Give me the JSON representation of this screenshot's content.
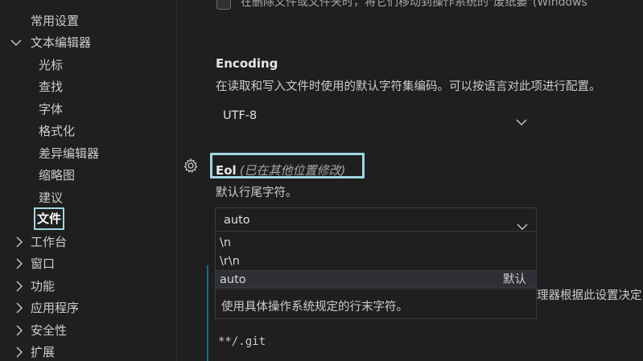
{
  "sidebar": {
    "items": [
      {
        "label": "常用设置",
        "expandable": false
      },
      {
        "label": "文本编辑器",
        "expandable": true,
        "expanded": true
      },
      {
        "label": "光标",
        "child": true
      },
      {
        "label": "查找",
        "child": true
      },
      {
        "label": "字体",
        "child": true
      },
      {
        "label": "格式化",
        "child": true
      },
      {
        "label": "差异编辑器",
        "child": true
      },
      {
        "label": "缩略图",
        "child": true
      },
      {
        "label": "建议",
        "child": true
      },
      {
        "label": "文件",
        "child": true,
        "active": true
      },
      {
        "label": "工作台",
        "expandable": true
      },
      {
        "label": "窗口",
        "expandable": true
      },
      {
        "label": "功能",
        "expandable": true
      },
      {
        "label": "应用程序",
        "expandable": true
      },
      {
        "label": "安全性",
        "expandable": true
      },
      {
        "label": "扩展",
        "expandable": true
      }
    ]
  },
  "main": {
    "top_clipped": "在删除文件或文件夹时，将它们移动到操作系统的\"废纸篓\"(Windows",
    "encoding": {
      "title": "Encoding",
      "description": "在读取和写入文件时使用的默认字符集编码。可以按语言对此项进行配置。",
      "value": "UTF-8"
    },
    "eol": {
      "title": "Eol",
      "modified_note": "(已在其他位置修改)",
      "description": "默认行尾字符。",
      "value": "auto",
      "options": [
        "\\n",
        "\\r\\n",
        "auto"
      ],
      "default_label": "默认",
      "option_description": "使用具体操作系统规定的行末字符。"
    },
    "behind_text": "理器根据此设置决定",
    "exclude_example": "**/.git"
  },
  "colors": {
    "focus_outline": "#9fd6e3",
    "background": "#1f1f1f",
    "accent_bar": "#0e6e87"
  }
}
